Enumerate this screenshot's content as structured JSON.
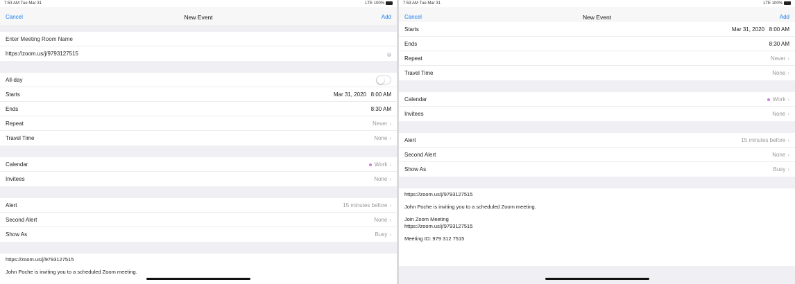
{
  "left": {
    "status": {
      "time": "7:53 AM  Tue Mar 31",
      "signal": "LTE 100%"
    },
    "nav": {
      "cancel": "Cancel",
      "title": "New Event",
      "add": "Add"
    },
    "title_placeholder": "Enter Meeting Room Name",
    "location": "https://zoom.us/j/9793127515",
    "allday_label": "All-day",
    "starts_label": "Starts",
    "starts_date": "Mar 31, 2020",
    "starts_time": "8:00 AM",
    "ends_label": "Ends",
    "ends_value": "8:30 AM",
    "repeat_label": "Repeat",
    "repeat_value": "Never",
    "travel_label": "Travel Time",
    "travel_value": "None",
    "calendar_label": "Calendar",
    "calendar_value": "Work",
    "invitees_label": "Invitees",
    "invitees_value": "None",
    "alert_label": "Alert",
    "alert_value": "15 minutes before",
    "second_alert_label": "Second Alert",
    "second_alert_value": "None",
    "showas_label": "Show As",
    "showas_value": "Busy",
    "notes": {
      "line1": "https://zoom.us/j/9793127515",
      "line2": "John Poche is inviting you to a scheduled Zoom meeting."
    }
  },
  "right": {
    "status": {
      "time": "7:53 AM  Tue Mar 31",
      "signal": "LTE 100%"
    },
    "nav": {
      "cancel": "Cancel",
      "title": "New Event",
      "add": "Add"
    },
    "starts_label": "Starts",
    "starts_date": "Mar 31, 2020",
    "starts_time": "8:00 AM",
    "ends_label": "Ends",
    "ends_value": "8:30 AM",
    "repeat_label": "Repeat",
    "repeat_value": "Never",
    "travel_label": "Travel Time",
    "travel_value": "None",
    "calendar_label": "Calendar",
    "calendar_value": "Work",
    "invitees_label": "Invitees",
    "invitees_value": "None",
    "alert_label": "Alert",
    "alert_value": "15 minutes before",
    "second_alert_label": "Second Alert",
    "second_alert_value": "None",
    "showas_label": "Show As",
    "showas_value": "Busy",
    "notes": {
      "line1": "https://zoom.us/j/9793127515",
      "line2": "John Poche is inviting you to a scheduled Zoom meeting.",
      "line3a": "Join Zoom Meeting",
      "line3b": "https://zoom.us/j/9793127515",
      "line4": "Meeting ID: 979 312 7515"
    }
  },
  "colors": {
    "accent": "#1a7cf0",
    "calendar_dot": "#c97ce0",
    "group_bg": "#efeff4"
  }
}
